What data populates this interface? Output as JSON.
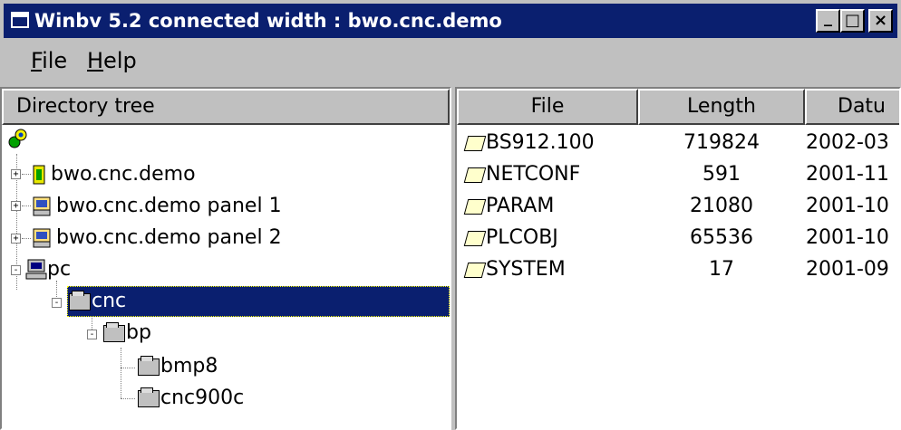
{
  "window": {
    "title": "Winbv 5.2 connected width : bwo.cnc.demo",
    "controls": {
      "minimize": "_",
      "maximize": "□",
      "close": "×"
    }
  },
  "menu": [
    {
      "mnemonic": "F",
      "rest": "ile"
    },
    {
      "mnemonic": "H",
      "rest": "elp"
    }
  ],
  "tree": {
    "header": "Directory tree",
    "nodes": [
      {
        "label": "bwo.cnc.demo",
        "icon": "cnc-controller-icon"
      },
      {
        "label": "bwo.cnc.demo panel 1",
        "icon": "panel-icon"
      },
      {
        "label": "bwo.cnc.demo panel 2",
        "icon": "panel-icon"
      },
      {
        "label": "pc",
        "icon": "computer-icon"
      },
      {
        "label": "cnc",
        "icon": "folder-icon",
        "selected": true
      },
      {
        "label": "bp",
        "icon": "folder-icon"
      },
      {
        "label": "bmp8",
        "icon": "folder-icon"
      },
      {
        "label": "cnc900c",
        "icon": "folder-icon"
      }
    ]
  },
  "files": {
    "columns": [
      "File",
      "Length",
      "Datu"
    ],
    "rows": [
      {
        "name": "BS912.100",
        "length": "719824",
        "date": "2002-03"
      },
      {
        "name": "NETCONF",
        "length": "591",
        "date": "2001-11"
      },
      {
        "name": "PARAM",
        "length": "21080",
        "date": "2001-10"
      },
      {
        "name": "PLCOBJ",
        "length": "65536",
        "date": "2001-10"
      },
      {
        "name": "SYSTEM",
        "length": "17",
        "date": "2001-09"
      }
    ]
  },
  "colors": {
    "title_bar": "#0a1f6f",
    "selection": "#0a1f6f",
    "face": "#c0c0c0"
  }
}
